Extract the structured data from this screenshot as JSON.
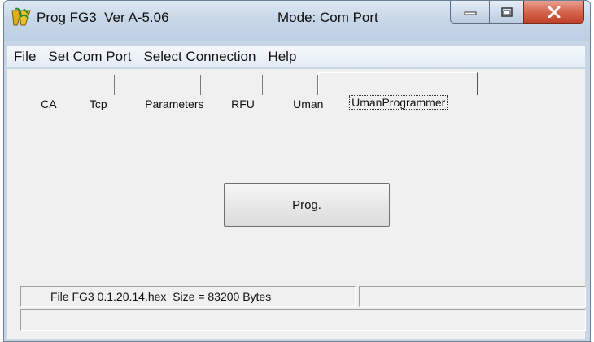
{
  "window": {
    "title": "Prog FG3  Ver A-5.06",
    "mode": "Mode: Com Port",
    "icons": {
      "app": "app-logo-icon",
      "minimize": "minimize-icon",
      "maximize": "maximize-icon",
      "close": "close-icon"
    }
  },
  "menu": {
    "items": [
      "File",
      "Set Com Port",
      "Select Connection",
      "Help"
    ]
  },
  "tabs": {
    "items": [
      "CA",
      "Tcp",
      "Parameters",
      "RFU",
      "Uman",
      "UmanProgrammer"
    ],
    "active": "UmanProgrammer"
  },
  "main": {
    "prog_button": "Prog."
  },
  "status": {
    "file_info": "File FG3 0.1.20.14.hex  Size = 83200 Bytes",
    "secondary": "",
    "message": ""
  }
}
